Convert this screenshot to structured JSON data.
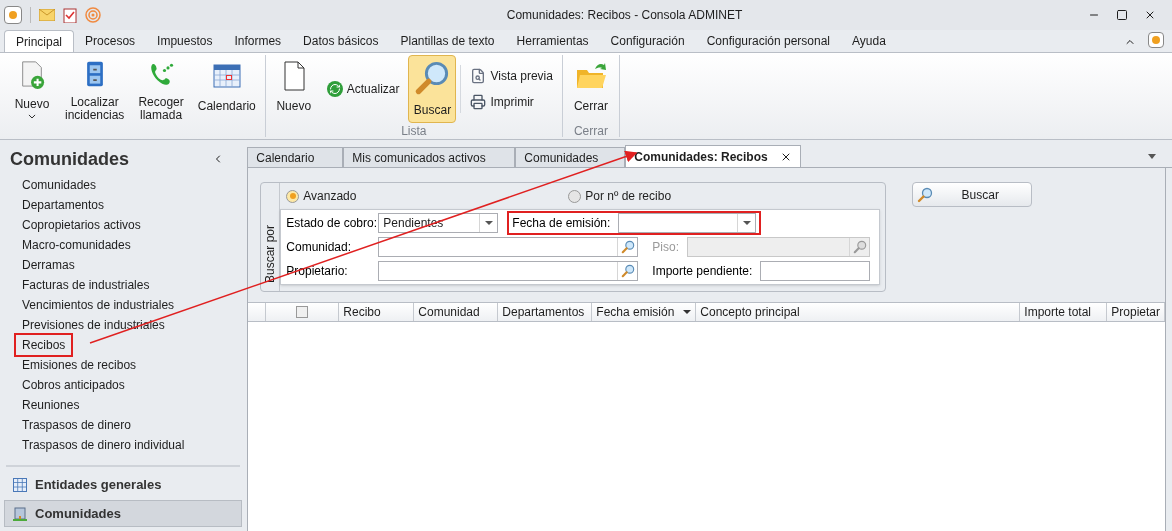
{
  "window": {
    "title": "Comunidades: Recibos - Consola ADMINET"
  },
  "ribbon_tabs": [
    {
      "label": "Principal",
      "selected": true
    },
    {
      "label": "Procesos",
      "selected": false
    },
    {
      "label": "Impuestos",
      "selected": false
    },
    {
      "label": "Informes",
      "selected": false
    },
    {
      "label": "Datos básicos",
      "selected": false
    },
    {
      "label": "Plantillas de texto",
      "selected": false
    },
    {
      "label": "Herramientas",
      "selected": false
    },
    {
      "label": "Configuración",
      "selected": false
    },
    {
      "label": "Configuración personal",
      "selected": false
    },
    {
      "label": "Ayuda",
      "selected": false
    }
  ],
  "ribbon_groups": [
    {
      "buttons": [
        {
          "kind": "large",
          "label": "Nuevo",
          "dropdown": true,
          "selected": false
        },
        {
          "kind": "large",
          "label": "Localizar incidencias",
          "selected": false
        },
        {
          "kind": "large",
          "label": "Recoger llamada",
          "selected": false
        },
        {
          "kind": "large",
          "label": "Calendario",
          "selected": false
        }
      ]
    },
    {
      "label": "Lista",
      "buttons": [
        {
          "kind": "large",
          "label": "Nuevo",
          "selected": false
        },
        {
          "kind": "small",
          "label": "Actualizar",
          "selected": false
        },
        {
          "kind": "large",
          "label": "Buscar",
          "selected": true
        },
        {
          "kind": "stack",
          "label": "Vista previa",
          "selected": false
        },
        {
          "kind": "stack",
          "label": "Imprimir",
          "selected": false
        }
      ]
    },
    {
      "label": "Cerrar",
      "buttons": [
        {
          "kind": "large",
          "label": "Cerrar",
          "selected": false
        }
      ]
    }
  ],
  "sidebar": {
    "title": "Comunidades",
    "items": [
      {
        "label": "Comunidades",
        "highlighted": false
      },
      {
        "label": "Departamentos",
        "highlighted": false
      },
      {
        "label": "Copropietarios activos",
        "highlighted": false
      },
      {
        "label": "Macro-comunidades",
        "highlighted": false
      },
      {
        "label": "Derramas",
        "highlighted": false
      },
      {
        "label": "Facturas de industriales",
        "highlighted": false
      },
      {
        "label": "Vencimientos de industriales",
        "highlighted": false
      },
      {
        "label": "Previsiones de industriales",
        "highlighted": false
      },
      {
        "label": "Recibos",
        "highlighted": true
      },
      {
        "label": "Emisiones de recibos",
        "highlighted": false
      },
      {
        "label": "Cobros anticipados",
        "highlighted": false
      },
      {
        "label": "Reuniones",
        "highlighted": false
      },
      {
        "label": "Traspasos de dinero",
        "highlighted": false
      },
      {
        "label": "Traspasos de dinero individual",
        "highlighted": false
      }
    ],
    "nav_buttons": [
      {
        "label": "Entidades generales",
        "selected": false
      },
      {
        "label": "Comunidades",
        "selected": true
      }
    ]
  },
  "doc_tabs": [
    {
      "label": "Calendario",
      "selected": false
    },
    {
      "label": "Mis comunicados activos",
      "selected": false
    },
    {
      "label": "Comunidades",
      "selected": false
    },
    {
      "label": "Comunidades: Recibos",
      "selected": true
    }
  ],
  "search": {
    "group_label": "Buscar por",
    "modes": [
      {
        "label": "Avanzado",
        "selected": true
      },
      {
        "label": "Por nº de recibo",
        "selected": false
      }
    ],
    "fields": [
      {
        "kind": "dropdown",
        "label": "Estado de cobro:",
        "value": "Pendientes",
        "disabled": false,
        "highlighted": false
      },
      {
        "kind": "dropdown",
        "label": "Fecha de emisión:",
        "disabled": false,
        "highlighted": true
      },
      {
        "kind": "lookup",
        "label": "Comunidad:",
        "disabled": false,
        "highlighted": false
      },
      {
        "kind": "lookup",
        "label": "Piso:",
        "disabled": true,
        "highlighted": false
      },
      {
        "kind": "lookup",
        "label": "Propietario:",
        "disabled": false,
        "highlighted": false
      },
      {
        "kind": "text",
        "label": "Importe pendiente:",
        "disabled": false,
        "highlighted": false
      }
    ],
    "button": "Buscar"
  },
  "grid": {
    "select_all": {
      "checked": false
    },
    "columns": [
      {
        "label": "Recibo",
        "sorted": false
      },
      {
        "label": "Comunidad",
        "sorted": false
      },
      {
        "label": "Departamentos",
        "sorted": false
      },
      {
        "label": "Fecha emisión",
        "sorted": true
      },
      {
        "label": "Concepto principal",
        "sorted": false
      },
      {
        "label": "Importe total",
        "sorted": false
      },
      {
        "label": "Propietar",
        "sorted": false
      }
    ]
  },
  "annotation_arrow": true
}
